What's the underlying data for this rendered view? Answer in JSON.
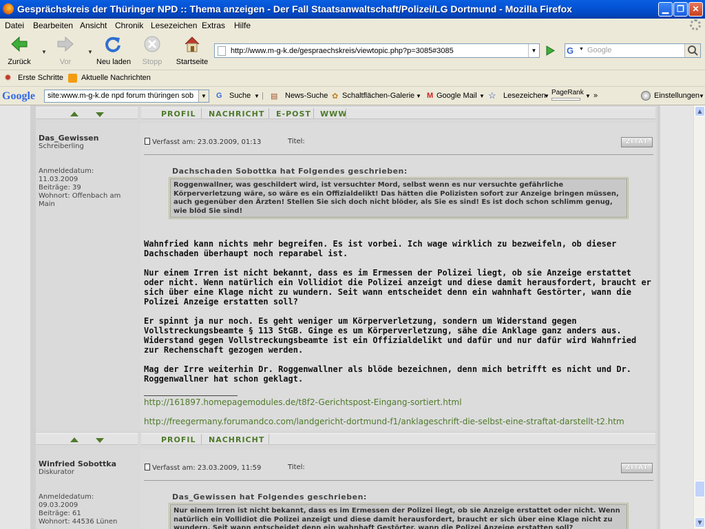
{
  "window": {
    "title": "Gesprächskreis der Thüringer NPD :: Thema anzeigen - Der Fall Staatsanwaltschaft/Polizei/LG Dortmund - Mozilla Firefox"
  },
  "menu": [
    "Datei",
    "Bearbeiten",
    "Ansicht",
    "Chronik",
    "Lesezeichen",
    "Extras",
    "Hilfe"
  ],
  "nav": {
    "back": "Zurück",
    "forward": "Vor",
    "reload": "Neu laden",
    "stop": "Stopp",
    "home": "Startseite",
    "url": "http://www.m-g-k.de/gespraechskreis/viewtopic.php?p=3085#3085",
    "search_engine": "G",
    "search_placeholder": "Google"
  },
  "bookmarks": [
    "Erste Schritte",
    "Aktuelle Nachrichten"
  ],
  "google_toolbar": {
    "logo": "Google",
    "query": "site:www.m-g-k.de npd forum thüringen sob",
    "suche": "Suche",
    "news": "News-Suche",
    "gallery": "Schaltflächen-Galerie",
    "mail": "Google Mail",
    "lesezeichen": "Lesezeichen",
    "pagerank": "PageRank",
    "more": "»",
    "settings": "Einstellungen"
  },
  "postbar_top": [
    "PROFIL",
    "NACHRICHT",
    "E-POST",
    "WWW"
  ],
  "postbar_bottom": [
    "PROFIL",
    "NACHRICHT"
  ],
  "posts": [
    {
      "author": "Das_Gewissen",
      "rank": "Schreiberling",
      "info": [
        "Anmeldedatum:",
        "11.03.2009",
        "Beiträge: 39",
        "Wohnort: Offenbach am Main"
      ],
      "meta": "Verfasst am: 23.03.2009, 01:13",
      "title_label": "Titel:",
      "quote_button": "ZITAT",
      "quote_head": "Dachschaden Sobottka hat Folgendes geschrieben:",
      "quote": "Roggenwallner, was geschildert wird, ist versuchter Mord, selbst wenn es nur versuchte gefährliche Körperverletzung wäre, so wäre es ein Offizialdelikt! Das hätten die Polizisten sofort zur Anzeige bringen müssen, auch gegenüber den Ärzten! Stellen Sie sich doch nicht blöder, als Sie es sind! Es ist doch schon schlimm genug, wie blöd Sie sind!",
      "body": [
        "Wahnfried kann nichts mehr begreifen. Es ist vorbei. Ich wage wirklich zu bezweifeln, ob dieser Dachschaden überhaupt noch reparabel ist.",
        "Nur einem Irren ist nicht bekannt, dass es im Ermessen der Polizei liegt, ob sie Anzeige erstattet oder nicht. Wenn natürlich ein Vollidiot die Polizei anzeigt und diese damit herausfordert, braucht er sich über eine Klage nicht zu wundern. Seit wann entscheidet denn ein wahnhaft Gestörter, wann die Polizei Anzeige erstatten soll?",
        "Er spinnt ja nur noch. Es geht weniger um Körperverletzung, sondern um Widerstand gegen Vollstreckungsbeamte § 113 StGB. Ginge es um Körperverletzung, sähe die Anklage ganz anders aus. Widerstand gegen Vollstreckungsbeamte ist ein Offizialdelikt und dafür und nur dafür wird Wahnfried zur Rechenschaft gezogen werden.",
        "Mag der Irre weiterhin Dr. Roggenwallner als blöde bezeichnen, denn mich betrifft es nicht und Dr. Roggenwallner hat schon geklagt."
      ],
      "links": [
        "http://161897.homepagemodules.de/t8f2-Gerichtspost-Eingang-sortiert.html",
        "http://freegermany.forumandco.com/landgericht-dortmund-f1/anklageschrift-die-selbst-eine-straftat-darstellt-t2.htm"
      ]
    },
    {
      "author": "Winfried Sobottka",
      "rank": "Diskurator",
      "info": [
        "Anmeldedatum:",
        "09.03.2009",
        "Beiträge: 61",
        "Wohnort: 44536 Lünen"
      ],
      "meta": "Verfasst am: 23.03.2009, 11:59",
      "title_label": "Titel:",
      "quote_button": "ZITAT",
      "quote_head": "Das_Gewissen hat Folgendes geschrieben:",
      "quote": "Nur einem Irren ist nicht bekannt, dass es im Ermessen der Polizei liegt, ob sie Anzeige erstattet oder nicht. Wenn natürlich ein Vollidiot die Polizei anzeigt und diese damit herausfordert, braucht er sich über eine Klage nicht zu wundern. Seit wann entscheidet denn ein wahnhaft Gestörter, wann die Polizei Anzeige erstatten soll?"
    }
  ]
}
